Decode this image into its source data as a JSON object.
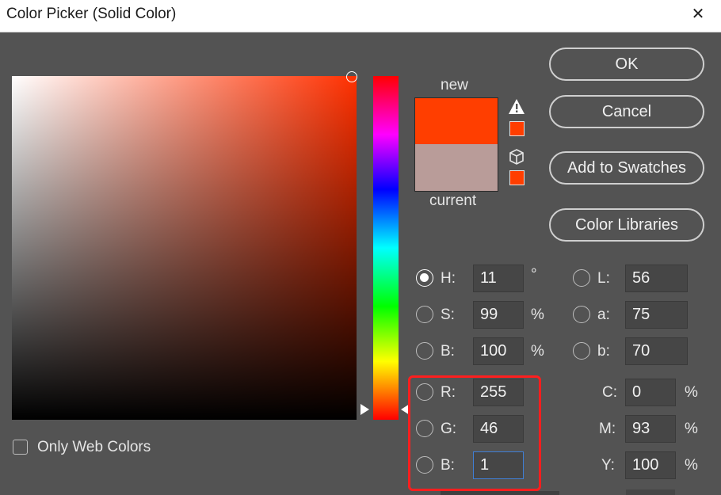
{
  "window": {
    "title": "Color Picker (Solid Color)",
    "close_glyph": "✕"
  },
  "preview": {
    "new_label": "new",
    "current_label": "current",
    "new_color": "#ff3e00",
    "current_color": "#b99c99"
  },
  "buttons": {
    "ok": "OK",
    "cancel": "Cancel",
    "add_swatches": "Add to Swatches",
    "libraries": "Color Libraries"
  },
  "hsb": {
    "h": {
      "label": "H:",
      "value": "11",
      "unit": "°",
      "selected": true
    },
    "s": {
      "label": "S:",
      "value": "99",
      "unit": "%"
    },
    "b": {
      "label": "B:",
      "value": "100",
      "unit": "%"
    }
  },
  "rgb": {
    "r": {
      "label": "R:",
      "value": "255"
    },
    "g": {
      "label": "G:",
      "value": "46"
    },
    "b": {
      "label": "B:",
      "value": "1"
    }
  },
  "lab": {
    "l": {
      "label": "L:",
      "value": "56"
    },
    "a": {
      "label": "a:",
      "value": "75"
    },
    "b": {
      "label": "b:",
      "value": "70"
    }
  },
  "cmyk": {
    "c": {
      "label": "C:",
      "value": "0",
      "unit": "%"
    },
    "m": {
      "label": "M:",
      "value": "93",
      "unit": "%"
    },
    "y": {
      "label": "Y:",
      "value": "100",
      "unit": "%"
    }
  },
  "options": {
    "only_web_colors": "Only Web Colors"
  },
  "icons": {
    "gamut_warning": "warning-triangle-icon",
    "web_safe": "cube-icon"
  }
}
